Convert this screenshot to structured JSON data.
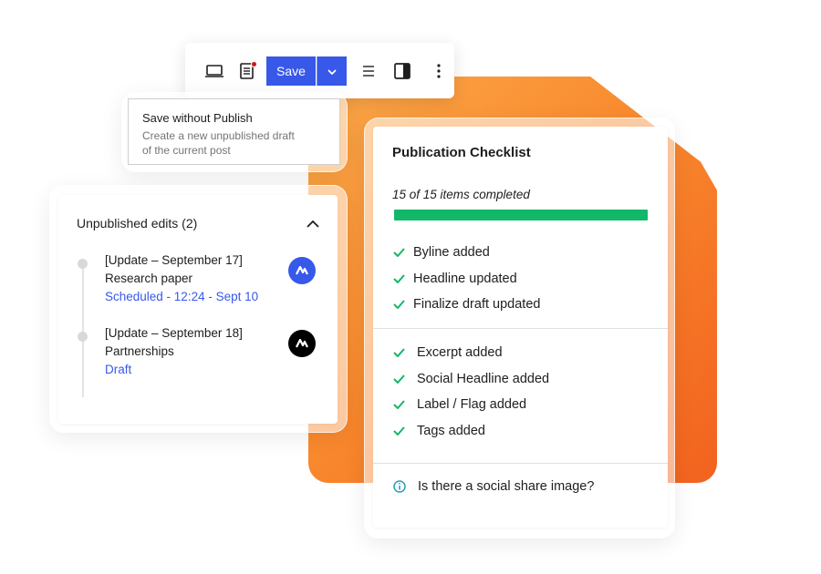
{
  "toolbar": {
    "save_label": "Save",
    "icons": [
      "laptop-icon",
      "document-icon",
      "chevron-down-icon",
      "list-view-icon",
      "sidebar-toggle-icon",
      "more-vertical-icon"
    ],
    "accent": "#3858e9",
    "notification_dot_color": "#cc1818"
  },
  "save_menu": {
    "title": "Save without Publish",
    "description_line1": "Create a new unpublished draft",
    "description_line2": "of the current post"
  },
  "unpublished_edits": {
    "header": "Unpublished edits (2)",
    "items": [
      {
        "title_line1": "[Update – September 17]",
        "title_line2": "Research paper",
        "status": "Scheduled - 12:24 - Sept 10",
        "avatar_color": "#3858e9"
      },
      {
        "title_line1": "[Update – September 18]",
        "title_line2": "Partnerships",
        "status": "Draft",
        "avatar_color": "#000000"
      }
    ]
  },
  "checklist": {
    "title": "Publication Checklist",
    "progress_label": "15 of 15 items completed",
    "progress_completed": 15,
    "progress_total": 15,
    "progress_color": "#12b76a",
    "group1": [
      "Byline added",
      "Headline updated",
      "Finalize draft updated"
    ],
    "group2": [
      "Excerpt added",
      "Social Headline added",
      "Label / Flag added",
      "Tags added"
    ],
    "info_item": "Is there a social share image?",
    "check_color": "#12b76a"
  },
  "background": {
    "accent_gradient": [
      "#fba94a",
      "#f98a2e",
      "#f2621f"
    ]
  }
}
